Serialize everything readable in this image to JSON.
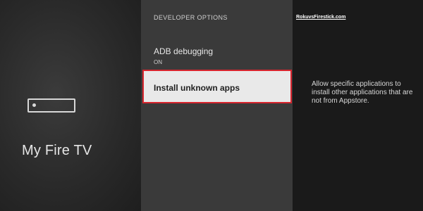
{
  "device": {
    "title": "My Fire TV",
    "icon": "fire-tv-stick-icon"
  },
  "developer_options": {
    "header": "DEVELOPER OPTIONS",
    "items": [
      {
        "label": "ADB debugging",
        "value": "ON"
      },
      {
        "label": "Install unknown apps",
        "value": ""
      }
    ],
    "selected_index": 1
  },
  "detail": {
    "watermark": "RokuvsFirestick.com",
    "description": "Allow specific applications to install other applications that are not from Appstore."
  },
  "colors": {
    "highlight_border": "#d8252e",
    "selected_bg": "#e9e9e9",
    "middle_bg": "#3a3a3a",
    "right_bg": "#1a1a1a"
  }
}
